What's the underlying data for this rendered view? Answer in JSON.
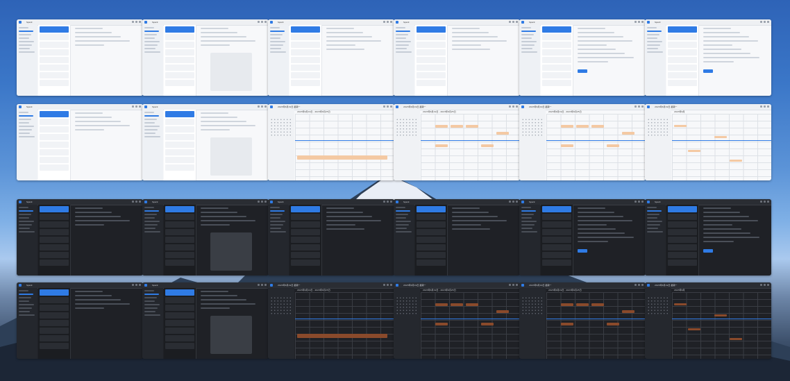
{
  "window_title": "Spark",
  "mail_app_title": "Spark",
  "calendar_header": "2023年6月19日 - 2023年6月25日",
  "calendar_header_day": "2023年6月19日 星期一",
  "calendar_header_month": "2023年6月",
  "colors": {
    "accent": "#2f7be5"
  },
  "tiles": [
    {
      "kind": "mail",
      "theme": "light"
    },
    {
      "kind": "mail-article",
      "theme": "light"
    },
    {
      "kind": "mail-compose",
      "theme": "light"
    },
    {
      "kind": "mail-compose",
      "theme": "light"
    },
    {
      "kind": "mail-settings",
      "theme": "light"
    },
    {
      "kind": "mail-settings",
      "theme": "light"
    },
    {
      "kind": "mail",
      "theme": "light"
    },
    {
      "kind": "mail-article",
      "theme": "light"
    },
    {
      "kind": "calendar-day",
      "theme": "light"
    },
    {
      "kind": "calendar-week",
      "theme": "light"
    },
    {
      "kind": "calendar-week",
      "theme": "light"
    },
    {
      "kind": "calendar-month",
      "theme": "light"
    },
    {
      "kind": "mail",
      "theme": "dark"
    },
    {
      "kind": "mail-article",
      "theme": "dark"
    },
    {
      "kind": "mail-compose",
      "theme": "dark"
    },
    {
      "kind": "mail-compose",
      "theme": "dark"
    },
    {
      "kind": "mail-settings",
      "theme": "dark"
    },
    {
      "kind": "mail-settings",
      "theme": "dark"
    },
    {
      "kind": "mail",
      "theme": "dark"
    },
    {
      "kind": "mail-article",
      "theme": "dark"
    },
    {
      "kind": "calendar-day",
      "theme": "dark"
    },
    {
      "kind": "calendar-week",
      "theme": "dark"
    },
    {
      "kind": "calendar-week",
      "theme": "dark"
    },
    {
      "kind": "calendar-month",
      "theme": "dark"
    }
  ]
}
